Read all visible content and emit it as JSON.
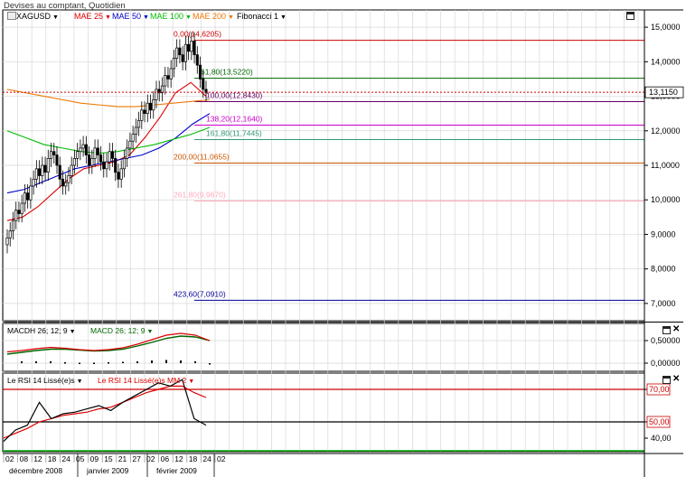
{
  "window_title": "Devises au comptant, Quotidien",
  "header": {
    "symbol": "XAGUSD",
    "indicators": [
      {
        "label": "MAE 25",
        "color": "#dd0000"
      },
      {
        "label": "MAE 50",
        "color": "#0000cc"
      },
      {
        "label": "MAE 100",
        "color": "#00bb00"
      },
      {
        "label": "MAE 200",
        "color": "#ee7700"
      },
      {
        "label": "Fibonacci 1",
        "color": "#000000"
      }
    ]
  },
  "macd_panel": {
    "labels": [
      {
        "text": "MACDH 26; 12; 9",
        "color": "#000000"
      },
      {
        "text": "MACD 26; 12; 9",
        "color": "#006600"
      }
    ]
  },
  "rsi_panel": {
    "labels": [
      {
        "text": "Le RSI 14 Lissé(e)s",
        "color": "#000000"
      },
      {
        "text": "Le RSI 14 Lissé(e)s MM 2",
        "color": "#dd0000"
      }
    ]
  },
  "chart_data": {
    "type": "candlestick",
    "title": "Devises au comptant, Quotidien",
    "symbol": "XAGUSD",
    "price_axis": {
      "ticks": [
        "15,0000",
        "14,0000",
        "13,0000",
        "12,0000",
        "11,0000",
        "10,0000",
        "9,0000",
        "8,0000",
        "7,0000"
      ],
      "min": 6.5,
      "max": 15.5
    },
    "current_price": {
      "value": 13.115,
      "label": "13,1150"
    },
    "date_ticks": [
      "02",
      "08",
      "12",
      "18",
      "24",
      "05",
      "09",
      "15",
      "21",
      "27",
      "02",
      "06",
      "12",
      "18",
      "24",
      "02"
    ],
    "month_labels": [
      "décembre 2008",
      "janvier 2009",
      "février 2009"
    ],
    "closes": [
      8.9,
      9.1,
      9.4,
      9.7,
      9.6,
      9.9,
      10.2,
      10.0,
      10.4,
      10.6,
      10.9,
      10.7,
      11.0,
      10.8,
      11.2,
      11.4,
      11.3,
      11.0,
      10.6,
      10.4,
      10.5,
      10.7,
      11.0,
      11.2,
      11.4,
      11.5,
      11.6,
      11.3,
      11.0,
      11.2,
      11.5,
      11.3,
      11.1,
      10.9,
      11.1,
      11.4,
      11.2,
      10.8,
      10.6,
      10.9,
      11.2,
      11.5,
      11.7,
      11.9,
      12.1,
      12.3,
      12.6,
      12.5,
      12.8,
      12.6,
      12.9,
      13.2,
      13.1,
      13.3,
      13.6,
      13.5,
      13.8,
      14.1,
      14.4,
      14.2,
      14.0,
      14.5,
      14.3,
      14.6,
      14.2,
      13.9,
      13.5,
      13.2,
      13.1
    ],
    "moving_averages": [
      {
        "name": "MAE 25",
        "color": "#dd0000",
        "values": [
          9.4,
          9.5,
          9.8,
          10.2,
          10.6,
          10.9,
          11.0,
          11.1,
          11.3,
          11.8,
          12.4,
          13.1,
          13.4,
          13.0
        ]
      },
      {
        "name": "MAE 50",
        "color": "#0000cc",
        "values": [
          10.2,
          10.3,
          10.5,
          10.7,
          10.9,
          11.0,
          11.1,
          11.2,
          11.3,
          11.5,
          11.8,
          12.2,
          12.5
        ]
      },
      {
        "name": "MAE 100",
        "color": "#00bb00",
        "values": [
          12.0,
          11.8,
          11.6,
          11.5,
          11.4,
          11.35,
          11.4,
          11.5,
          11.6,
          11.75,
          11.9,
          12.1
        ]
      },
      {
        "name": "MAE 200",
        "color": "#ee7700",
        "values": [
          13.2,
          13.1,
          13.0,
          12.9,
          12.8,
          12.75,
          12.7,
          12.7,
          12.75,
          12.8,
          12.85,
          12.9
        ]
      }
    ],
    "fibonacci": [
      {
        "label": "0,00(14,6205)",
        "value": 14.6205,
        "color": "#cc0000"
      },
      {
        "label": "61,80(13,5220)",
        "value": 13.522,
        "color": "#006600"
      },
      {
        "label": "100,00(12,8430)",
        "value": 12.843,
        "color": "#660066"
      },
      {
        "label": "138,20(12,1640)",
        "value": 12.164,
        "color": "#cc00cc"
      },
      {
        "label": "161,80(11,7445)",
        "value": 11.7445,
        "color": "#339977"
      },
      {
        "label": "200,00(11,0655)",
        "value": 11.0655,
        "color": "#cc5500"
      },
      {
        "label": "261,80(9,9670)",
        "value": 9.967,
        "color": "#ffaabb"
      },
      {
        "label": "423,60(7,0910)",
        "value": 7.091,
        "color": "#000099"
      }
    ],
    "macd": {
      "axis_ticks": [
        "0,50000",
        "0,00000"
      ],
      "macd_line": [
        0.25,
        0.28,
        0.32,
        0.35,
        0.33,
        0.3,
        0.28,
        0.3,
        0.34,
        0.42,
        0.52,
        0.62,
        0.66,
        0.62,
        0.5
      ],
      "signal_line": [
        0.2,
        0.24,
        0.28,
        0.31,
        0.31,
        0.29,
        0.27,
        0.28,
        0.31,
        0.38,
        0.46,
        0.55,
        0.6,
        0.58,
        0.5
      ]
    },
    "rsi": {
      "axis_ticks": [
        "70,00",
        "50,00",
        "40,00"
      ],
      "levels": [
        70,
        50
      ],
      "rsi_line": [
        38,
        45,
        48,
        62,
        52,
        55,
        56,
        58,
        60,
        57,
        62,
        66,
        70,
        74,
        72,
        76,
        52,
        48
      ],
      "rsi_ma": [
        40,
        43,
        46,
        50,
        52,
        54,
        55,
        56,
        58,
        59,
        62,
        65,
        68,
        70,
        72,
        72,
        68,
        65
      ]
    }
  }
}
